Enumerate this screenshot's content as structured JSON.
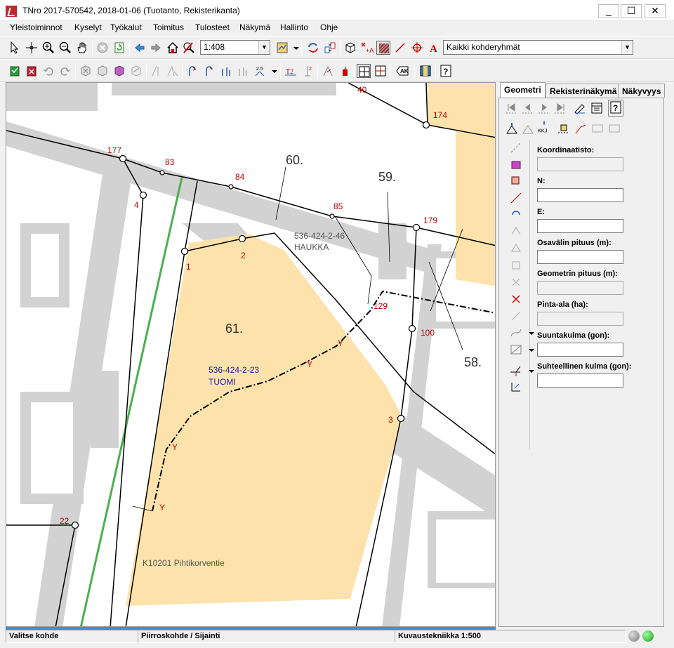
{
  "window": {
    "title": "TNro 2017-570542, 2018-01-06 (Tuotanto, Rekisterikanta)",
    "minimize": "_",
    "maximize": "☐",
    "close": "✕"
  },
  "menu": [
    "Yleistoiminnot",
    "Kyselyt",
    "Työkalut",
    "Toimitus",
    "Tulosteet",
    "Näkymä",
    "Hallinto",
    "Ohje"
  ],
  "toolbar1": {
    "icons": [
      "select-icon",
      "pan-crosshair-icon",
      "zoom-in-icon",
      "zoom-out-icon",
      "hand-icon",
      "stop-icon",
      "refresh-icon",
      "back-icon",
      "forward-icon",
      "home-icon",
      "locate-icon",
      "layers-icon",
      "swap-icon",
      "swap2-icon",
      "cube-icon",
      "label-icon",
      "hatch-icon",
      "line-icon",
      "target-icon",
      "text-icon"
    ],
    "scale_value": "1:408",
    "group_value": "Kaikki kohderyhmät"
  },
  "side": {
    "tabs": [
      "Geometri",
      "Rekisterinäkymä",
      "Näkyvyys"
    ],
    "nav_kkj": "KKJ",
    "fields": [
      {
        "label": "Koordinaatisto:",
        "value": "",
        "readonly": true
      },
      {
        "label": "N:",
        "value": "",
        "readonly": false
      },
      {
        "label": "E:",
        "value": "",
        "readonly": false
      },
      {
        "label": "Osavälin pituus (m):",
        "value": "",
        "readonly": false
      },
      {
        "label": "Geometrin pituus (m):",
        "value": "",
        "readonly": true
      },
      {
        "label": "Pinta-ala (ha):",
        "value": "",
        "readonly": true
      },
      {
        "label": "Suuntakulma (gon):",
        "value": "",
        "readonly": false
      },
      {
        "label": "Suhteellinen kulma (gon):",
        "value": "",
        "readonly": false
      }
    ]
  },
  "map": {
    "parcel_labels": [
      "60.",
      "59.",
      "61.",
      "58."
    ],
    "parcel_1_id": "536-424-2-46",
    "parcel_1_name": "HAUKKA",
    "parcel_2_id": "536-424-2-23",
    "parcel_2_name": "TUOMI",
    "road_label": "K10201 Pihtikorventie",
    "point_labels": [
      "40",
      "174",
      "177",
      "83",
      "84",
      "85",
      "179",
      "4",
      "2",
      "1",
      "129",
      "100",
      "3",
      "22"
    ],
    "y_marker": "Y",
    "colors": {
      "parcel_fill": "#fde3ab",
      "red_text": "#c00000",
      "blue_text": "#1a1aa8",
      "green_line": "#4caf50"
    }
  },
  "status": {
    "left": "Valitse kohde",
    "middle": "Piirroskohde / Sijainti",
    "right": "Kuvaustekniikka 1:500"
  }
}
